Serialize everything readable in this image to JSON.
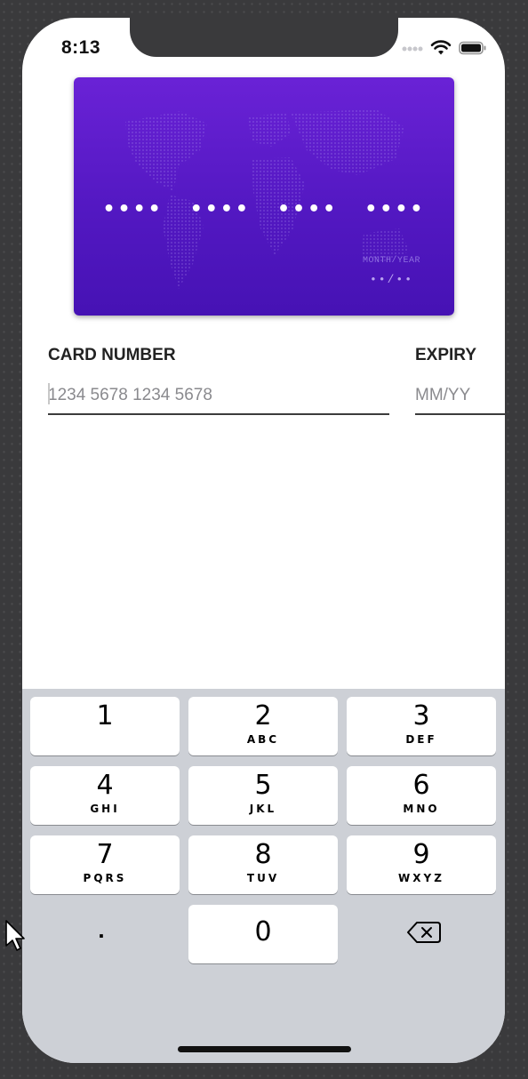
{
  "status_bar": {
    "time": "8:13",
    "icons": [
      "signal-dots-icon",
      "wifi-icon",
      "battery-icon"
    ]
  },
  "card_preview": {
    "number_groups": [
      "••••",
      "••••",
      "••••",
      "••••"
    ],
    "expiry_label": "MONTH/YEAR",
    "expiry_value": "••/••",
    "gradient_top": "#6a22d6",
    "gradient_bottom": "#4612b4"
  },
  "form": {
    "card_number": {
      "label": "CARD NUMBER",
      "placeholder": "1234 5678 1234 5678",
      "value": ""
    },
    "expiry": {
      "label": "EXPIRY",
      "placeholder": "MM/YY",
      "value": ""
    }
  },
  "keyboard": {
    "keys": [
      {
        "digit": "1",
        "letters": ""
      },
      {
        "digit": "2",
        "letters": "ABC"
      },
      {
        "digit": "3",
        "letters": "DEF"
      },
      {
        "digit": "4",
        "letters": "GHI"
      },
      {
        "digit": "5",
        "letters": "JKL"
      },
      {
        "digit": "6",
        "letters": "MNO"
      },
      {
        "digit": "7",
        "letters": "PQRS"
      },
      {
        "digit": "8",
        "letters": "TUV"
      },
      {
        "digit": "9",
        "letters": "WXYZ"
      }
    ],
    "dot_key": ".",
    "zero_key": "0",
    "delete_icon": "backspace-icon"
  }
}
